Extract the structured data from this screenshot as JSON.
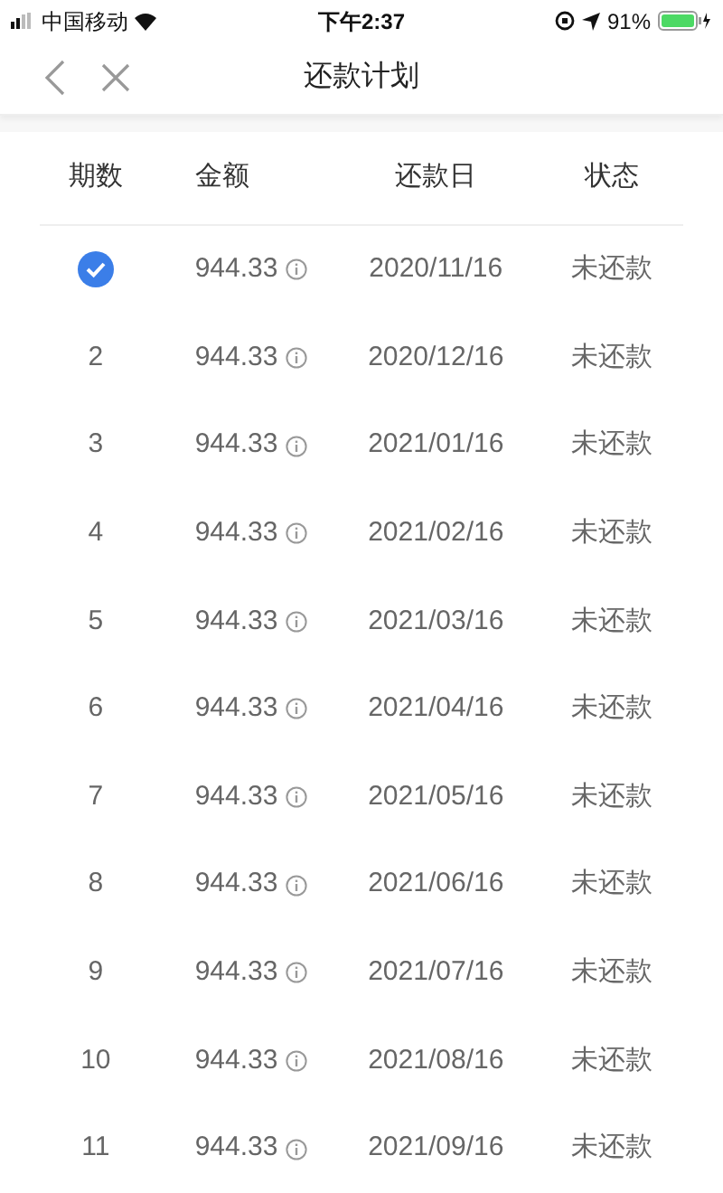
{
  "status_bar": {
    "carrier": "中国移动",
    "time": "下午2:37",
    "battery": "91%"
  },
  "nav": {
    "title": "还款计划"
  },
  "table": {
    "columns": [
      "期数",
      "金额",
      "还款日",
      "状态"
    ],
    "rows": [
      {
        "paid": true,
        "amount": "944.33",
        "date": "2020/11/16",
        "status": "未还款"
      },
      {
        "paid": false,
        "period": "2",
        "amount": "944.33",
        "date": "2020/12/16",
        "status": "未还款"
      },
      {
        "paid": false,
        "period": "3",
        "amount": "944.33",
        "date": "2021/01/16",
        "status": "未还款"
      },
      {
        "paid": false,
        "period": "4",
        "amount": "944.33",
        "date": "2021/02/16",
        "status": "未还款"
      },
      {
        "paid": false,
        "period": "5",
        "amount": "944.33",
        "date": "2021/03/16",
        "status": "未还款"
      },
      {
        "paid": false,
        "period": "6",
        "amount": "944.33",
        "date": "2021/04/16",
        "status": "未还款"
      },
      {
        "paid": false,
        "period": "7",
        "amount": "944.33",
        "date": "2021/05/16",
        "status": "未还款"
      },
      {
        "paid": false,
        "period": "8",
        "amount": "944.33",
        "date": "2021/06/16",
        "status": "未还款"
      },
      {
        "paid": false,
        "period": "9",
        "amount": "944.33",
        "date": "2021/07/16",
        "status": "未还款"
      },
      {
        "paid": false,
        "period": "10",
        "amount": "944.33",
        "date": "2021/08/16",
        "status": "未还款"
      },
      {
        "paid": false,
        "period": "11",
        "amount": "944.33",
        "date": "2021/09/16",
        "status": "未还款"
      }
    ]
  }
}
